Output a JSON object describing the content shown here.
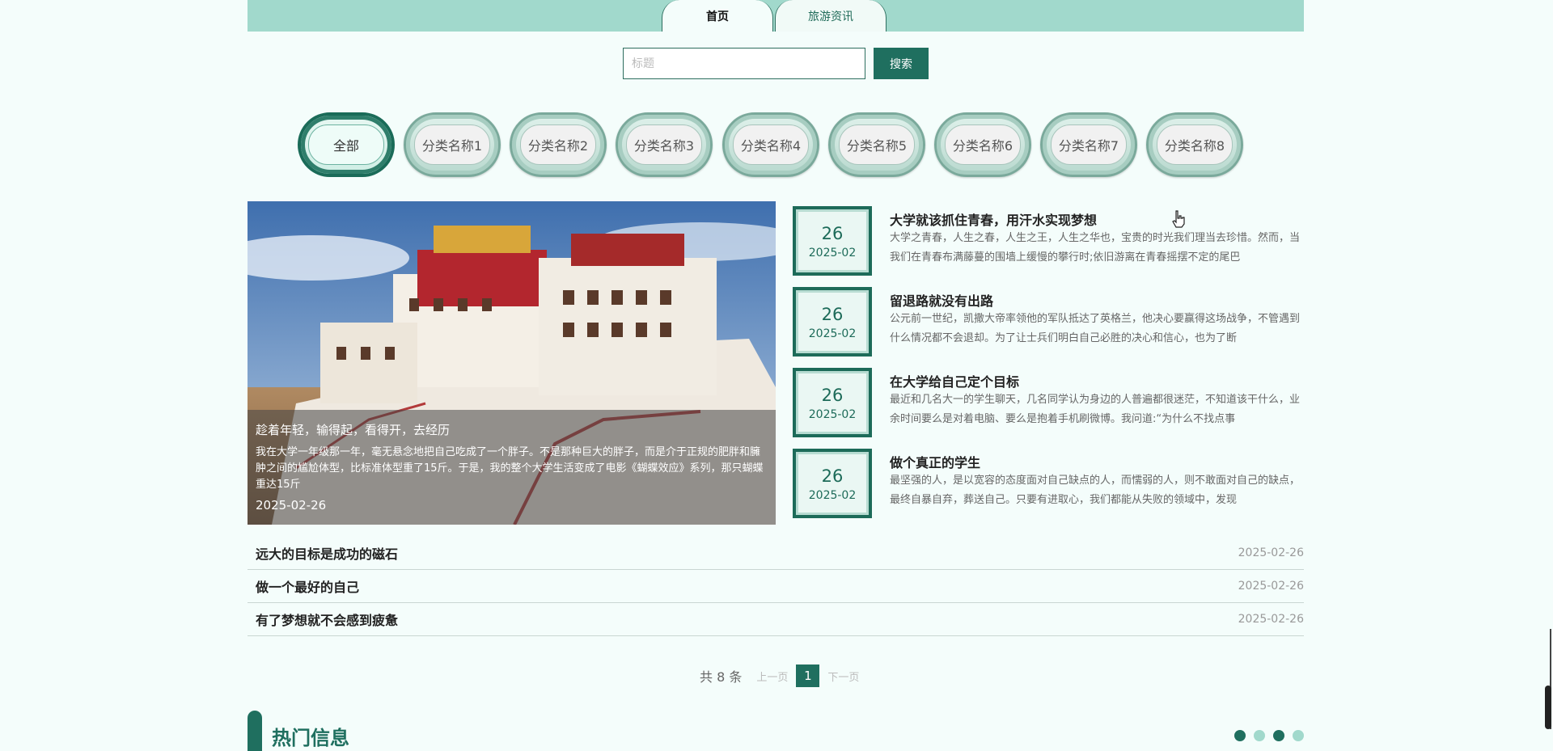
{
  "nav": {
    "tabs": [
      {
        "label": "首页"
      },
      {
        "label": "旅游资讯"
      }
    ]
  },
  "search": {
    "placeholder": "标题",
    "button_label": "搜索"
  },
  "categories": [
    {
      "label": "全部"
    },
    {
      "label": "分类名称1"
    },
    {
      "label": "分类名称2"
    },
    {
      "label": "分类名称3"
    },
    {
      "label": "分类名称4"
    },
    {
      "label": "分类名称5"
    },
    {
      "label": "分类名称6"
    },
    {
      "label": "分类名称7"
    },
    {
      "label": "分类名称8"
    }
  ],
  "featured": {
    "title": "趁着年轻，输得起，看得开，去经历",
    "description": "我在大学一年级那一年，毫无悬念地把自己吃成了一个胖子。不是那种巨大的胖子，而是介于正规的肥胖和臃肿之间的尴尬体型，比标准体型重了15斤。于是，我的整个大学生活变成了电影《蝴蝶效应》系列，那只蝴蝶重达15斤",
    "date": "2025-02-26"
  },
  "news": [
    {
      "day": "26",
      "ym": "2025-02",
      "title": "大学就该抓住青春，用汗水实现梦想",
      "desc": "大学之青春，人生之春，人生之王，人生之华也，宝贵的时光我们理当去珍惜。然而，当我们在青春布满藤蔓的围墙上缓慢的攀行时;依旧游离在青春摇摆不定的尾巴"
    },
    {
      "day": "26",
      "ym": "2025-02",
      "title": "留退路就没有出路",
      "desc": "公元前一世纪，凯撒大帝率领他的军队抵达了英格兰，他决心要赢得这场战争，不管遇到什么情况都不会退却。为了让士兵们明白自己必胜的决心和信心，也为了断"
    },
    {
      "day": "26",
      "ym": "2025-02",
      "title": "在大学给自己定个目标",
      "desc": "最近和几名大一的学生聊天，几名同学认为身边的人普遍都很迷茫，不知道该干什么，业余时间要么是对着电脑、要么是抱着手机刷微博。我问道:“为什么不找点事"
    },
    {
      "day": "26",
      "ym": "2025-02",
      "title": "做个真正的学生",
      "desc": "最坚强的人，是以宽容的态度面对自己缺点的人，而懦弱的人，则不敢面对自己的缺点，最终自暴自弃，葬送自己。只要有进取心，我们都能从失败的领域中，发现"
    }
  ],
  "list": [
    {
      "title": "远大的目标是成功的磁石",
      "date": "2025-02-26"
    },
    {
      "title": "做一个最好的自己",
      "date": "2025-02-26"
    },
    {
      "title": "有了梦想就不会感到疲惫",
      "date": "2025-02-26"
    }
  ],
  "pagination": {
    "total": "共 8 条",
    "prev": "上一页",
    "current": "1",
    "next": "下一页"
  },
  "hot": {
    "title": "热门信息"
  },
  "colors": {
    "primary": "#1f6f5f",
    "topbar": "#a1d9cc",
    "background": "#f4fdfb"
  }
}
